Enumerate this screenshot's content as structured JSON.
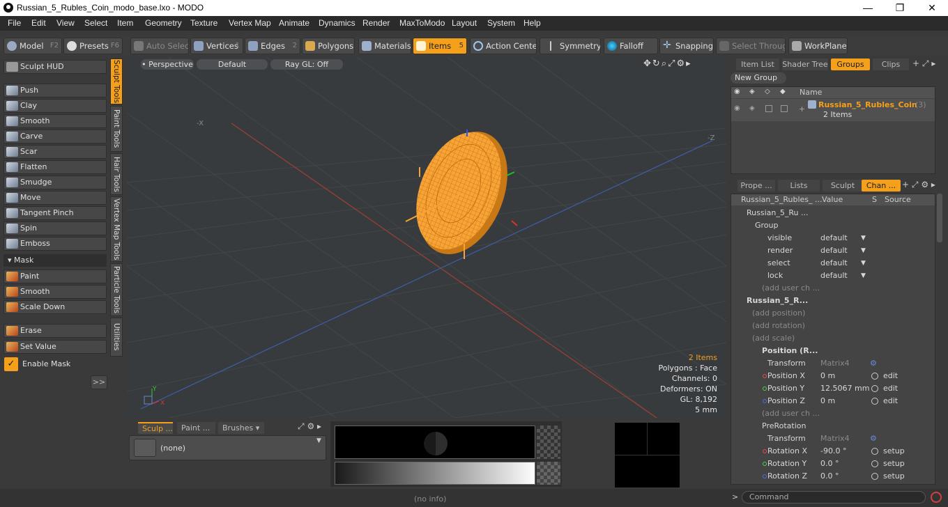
{
  "window": {
    "title": "Russian_5_Rubles_Coin_modo_base.lxo - MODO",
    "minimize": "—",
    "maximize": "❐",
    "close": "✕"
  },
  "menu": [
    "File",
    "Edit",
    "View",
    "Select",
    "Item",
    "Geometry",
    "Texture",
    "Vertex Map",
    "Animate",
    "Dynamics",
    "Render",
    "MaxToModo",
    "Layout",
    "System",
    "Help"
  ],
  "toolbar": {
    "model": "Model",
    "model_key": "F2",
    "presets": "Presets",
    "presets_key": "F6",
    "auto_select": "Auto Select",
    "vertices": "Vertices",
    "vertices_key": "1",
    "edges": "Edges",
    "edges_key": "2",
    "polygons": "Polygons",
    "materials": "Materials",
    "items": "Items",
    "items_key": "5",
    "action_center": "Action Center",
    "symmetry": "Symmetry",
    "falloff": "Falloff",
    "snapping": "Snapping",
    "select_through": "Select Through",
    "workplane": "WorkPlane"
  },
  "left": {
    "hud": "Sculpt HUD",
    "tools": [
      "Push",
      "Clay",
      "Smooth",
      "Carve",
      "Scar",
      "Flatten",
      "Smudge",
      "Move",
      "Tangent Pinch",
      "Spin",
      "Emboss"
    ],
    "mask_header": "Mask",
    "mask_tools": [
      "Paint",
      "Smooth",
      "Scale Down"
    ],
    "other_tools": [
      "Erase",
      "Set Value"
    ],
    "enable_mask": "Enable Mask",
    "expand": ">>",
    "vtabs": [
      "Sculpt Tools",
      "Paint Tools",
      "Hair Tools",
      "Vertex Map Tools",
      "Particle Tools",
      "Utilities"
    ]
  },
  "viewport": {
    "view": "Perspective",
    "shading": "Default",
    "raygl": "Ray GL: Off",
    "axis_x": "-X",
    "axis_z": "-Z",
    "gizmo_y": "Y",
    "gizmo_x": "X",
    "stats": {
      "items": "2 Items",
      "polygons": "Polygons : Face",
      "channels": "Channels: 0",
      "deformers": "Deformers: ON",
      "gl": "GL: 8,192",
      "unit": "5 mm"
    }
  },
  "bottom": {
    "tabs": [
      "Sculp ...",
      "Paint ...",
      "Brushes"
    ],
    "brush": "(none)"
  },
  "right_top": {
    "tabs": [
      "Item List",
      "Shader Tree",
      "Groups",
      "Clips"
    ],
    "new_group": "New Group",
    "name_col": "Name",
    "group_name": "Russian_5_Rubles_Coin",
    "group_count": "(3)",
    "group_items": "2 Items"
  },
  "right_bottom": {
    "tabs": [
      "Prope ...",
      "Lists",
      "Sculpt",
      "Chan ..."
    ],
    "cols": {
      "name": "Russian_5_Rubles_ ...",
      "value": "Value",
      "s": "S",
      "source": "Source"
    },
    "rows": [
      {
        "label": "Russian_5_Ru ...",
        "value": "",
        "src": ""
      },
      {
        "label": "Group",
        "value": "",
        "src": ""
      },
      {
        "label": "visible",
        "value": "default",
        "src": ""
      },
      {
        "label": "render",
        "value": "default",
        "src": ""
      },
      {
        "label": "select",
        "value": "default",
        "src": ""
      },
      {
        "label": "lock",
        "value": "default",
        "src": ""
      },
      {
        "label": "(add user ch ...",
        "value": "",
        "src": ""
      },
      {
        "label": "Russian_5_R...",
        "value": "",
        "src": ""
      },
      {
        "label": "(add position)",
        "value": "",
        "src": ""
      },
      {
        "label": "(add rotation)",
        "value": "",
        "src": ""
      },
      {
        "label": "(add scale)",
        "value": "",
        "src": ""
      },
      {
        "label": "Position (R...",
        "value": "",
        "src": ""
      },
      {
        "label": "Transform",
        "value": "Matrix4",
        "src": ""
      },
      {
        "label": "Position X",
        "value": "0 m",
        "src": "edit"
      },
      {
        "label": "Position Y",
        "value": "12.5067 mm",
        "src": "edit"
      },
      {
        "label": "Position Z",
        "value": "0 m",
        "src": "edit"
      },
      {
        "label": "(add user ch ...",
        "value": "",
        "src": ""
      },
      {
        "label": "PreRotation",
        "value": "",
        "src": ""
      },
      {
        "label": "Transform",
        "value": "Matrix4",
        "src": ""
      },
      {
        "label": "Rotation X",
        "value": "-90.0 °",
        "src": "setup"
      },
      {
        "label": "Rotation Y",
        "value": "0.0 °",
        "src": "setup"
      },
      {
        "label": "Rotation Z",
        "value": "0.0 °",
        "src": "setup"
      }
    ]
  },
  "status": {
    "info": "(no info)",
    "command": "Command",
    "prompt": ">"
  },
  "colors": {
    "accent": "#f5a01a",
    "bg": "#3a3a3a",
    "viewport": "#383b3e",
    "coin": "#f7a335"
  }
}
